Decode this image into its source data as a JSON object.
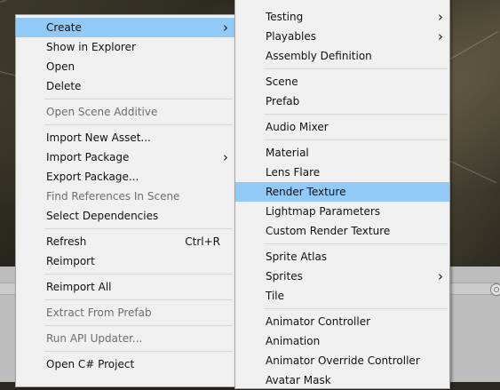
{
  "primary_menu": {
    "groups": [
      [
        {
          "label": "Create",
          "shortcut": "",
          "submenu": true,
          "disabled": false,
          "highlighted": true
        },
        {
          "label": "Show in Explorer",
          "shortcut": "",
          "submenu": false,
          "disabled": false,
          "highlighted": false
        },
        {
          "label": "Open",
          "shortcut": "",
          "submenu": false,
          "disabled": false,
          "highlighted": false
        },
        {
          "label": "Delete",
          "shortcut": "",
          "submenu": false,
          "disabled": false,
          "highlighted": false
        }
      ],
      [
        {
          "label": "Open Scene Additive",
          "shortcut": "",
          "submenu": false,
          "disabled": true,
          "highlighted": false
        }
      ],
      [
        {
          "label": "Import New Asset...",
          "shortcut": "",
          "submenu": false,
          "disabled": false,
          "highlighted": false
        },
        {
          "label": "Import Package",
          "shortcut": "",
          "submenu": true,
          "disabled": false,
          "highlighted": false
        },
        {
          "label": "Export Package...",
          "shortcut": "",
          "submenu": false,
          "disabled": false,
          "highlighted": false
        },
        {
          "label": "Find References In Scene",
          "shortcut": "",
          "submenu": false,
          "disabled": true,
          "highlighted": false
        },
        {
          "label": "Select Dependencies",
          "shortcut": "",
          "submenu": false,
          "disabled": false,
          "highlighted": false
        }
      ],
      [
        {
          "label": "Refresh",
          "shortcut": "Ctrl+R",
          "submenu": false,
          "disabled": false,
          "highlighted": false
        },
        {
          "label": "Reimport",
          "shortcut": "",
          "submenu": false,
          "disabled": false,
          "highlighted": false
        }
      ],
      [
        {
          "label": "Reimport All",
          "shortcut": "",
          "submenu": false,
          "disabled": false,
          "highlighted": false
        }
      ],
      [
        {
          "label": "Extract From Prefab",
          "shortcut": "",
          "submenu": false,
          "disabled": true,
          "highlighted": false
        }
      ],
      [
        {
          "label": "Run API Updater...",
          "shortcut": "",
          "submenu": false,
          "disabled": true,
          "highlighted": false
        }
      ],
      [
        {
          "label": "Open C# Project",
          "shortcut": "",
          "submenu": false,
          "disabled": false,
          "highlighted": false
        }
      ]
    ]
  },
  "create_submenu": {
    "groups": [
      [
        {
          "label": "Testing",
          "submenu": true,
          "highlighted": false
        },
        {
          "label": "Playables",
          "submenu": true,
          "highlighted": false
        },
        {
          "label": "Assembly Definition",
          "submenu": false,
          "highlighted": false
        }
      ],
      [
        {
          "label": "Scene",
          "submenu": false,
          "highlighted": false
        },
        {
          "label": "Prefab",
          "submenu": false,
          "highlighted": false
        }
      ],
      [
        {
          "label": "Audio Mixer",
          "submenu": false,
          "highlighted": false
        }
      ],
      [
        {
          "label": "Material",
          "submenu": false,
          "highlighted": false
        },
        {
          "label": "Lens Flare",
          "submenu": false,
          "highlighted": false
        },
        {
          "label": "Render Texture",
          "submenu": false,
          "highlighted": true
        },
        {
          "label": "Lightmap Parameters",
          "submenu": false,
          "highlighted": false
        },
        {
          "label": "Custom Render Texture",
          "submenu": false,
          "highlighted": false
        }
      ],
      [
        {
          "label": "Sprite Atlas",
          "submenu": false,
          "highlighted": false
        },
        {
          "label": "Sprites",
          "submenu": true,
          "highlighted": false
        },
        {
          "label": "Tile",
          "submenu": false,
          "highlighted": false
        }
      ],
      [
        {
          "label": "Animator Controller",
          "submenu": false,
          "highlighted": false
        },
        {
          "label": "Animation",
          "submenu": false,
          "highlighted": false
        },
        {
          "label": "Animator Override Controller",
          "submenu": false,
          "highlighted": false
        },
        {
          "label": "Avatar Mask",
          "submenu": false,
          "highlighted": false
        }
      ]
    ]
  },
  "colors": {
    "menu_background": "#f0f0f0",
    "highlight": "#91c9f7",
    "disabled_text": "#6d6d6d",
    "separator": "#d7d7d7"
  },
  "icons": {
    "submenu_arrow": "chevron-right-icon"
  }
}
